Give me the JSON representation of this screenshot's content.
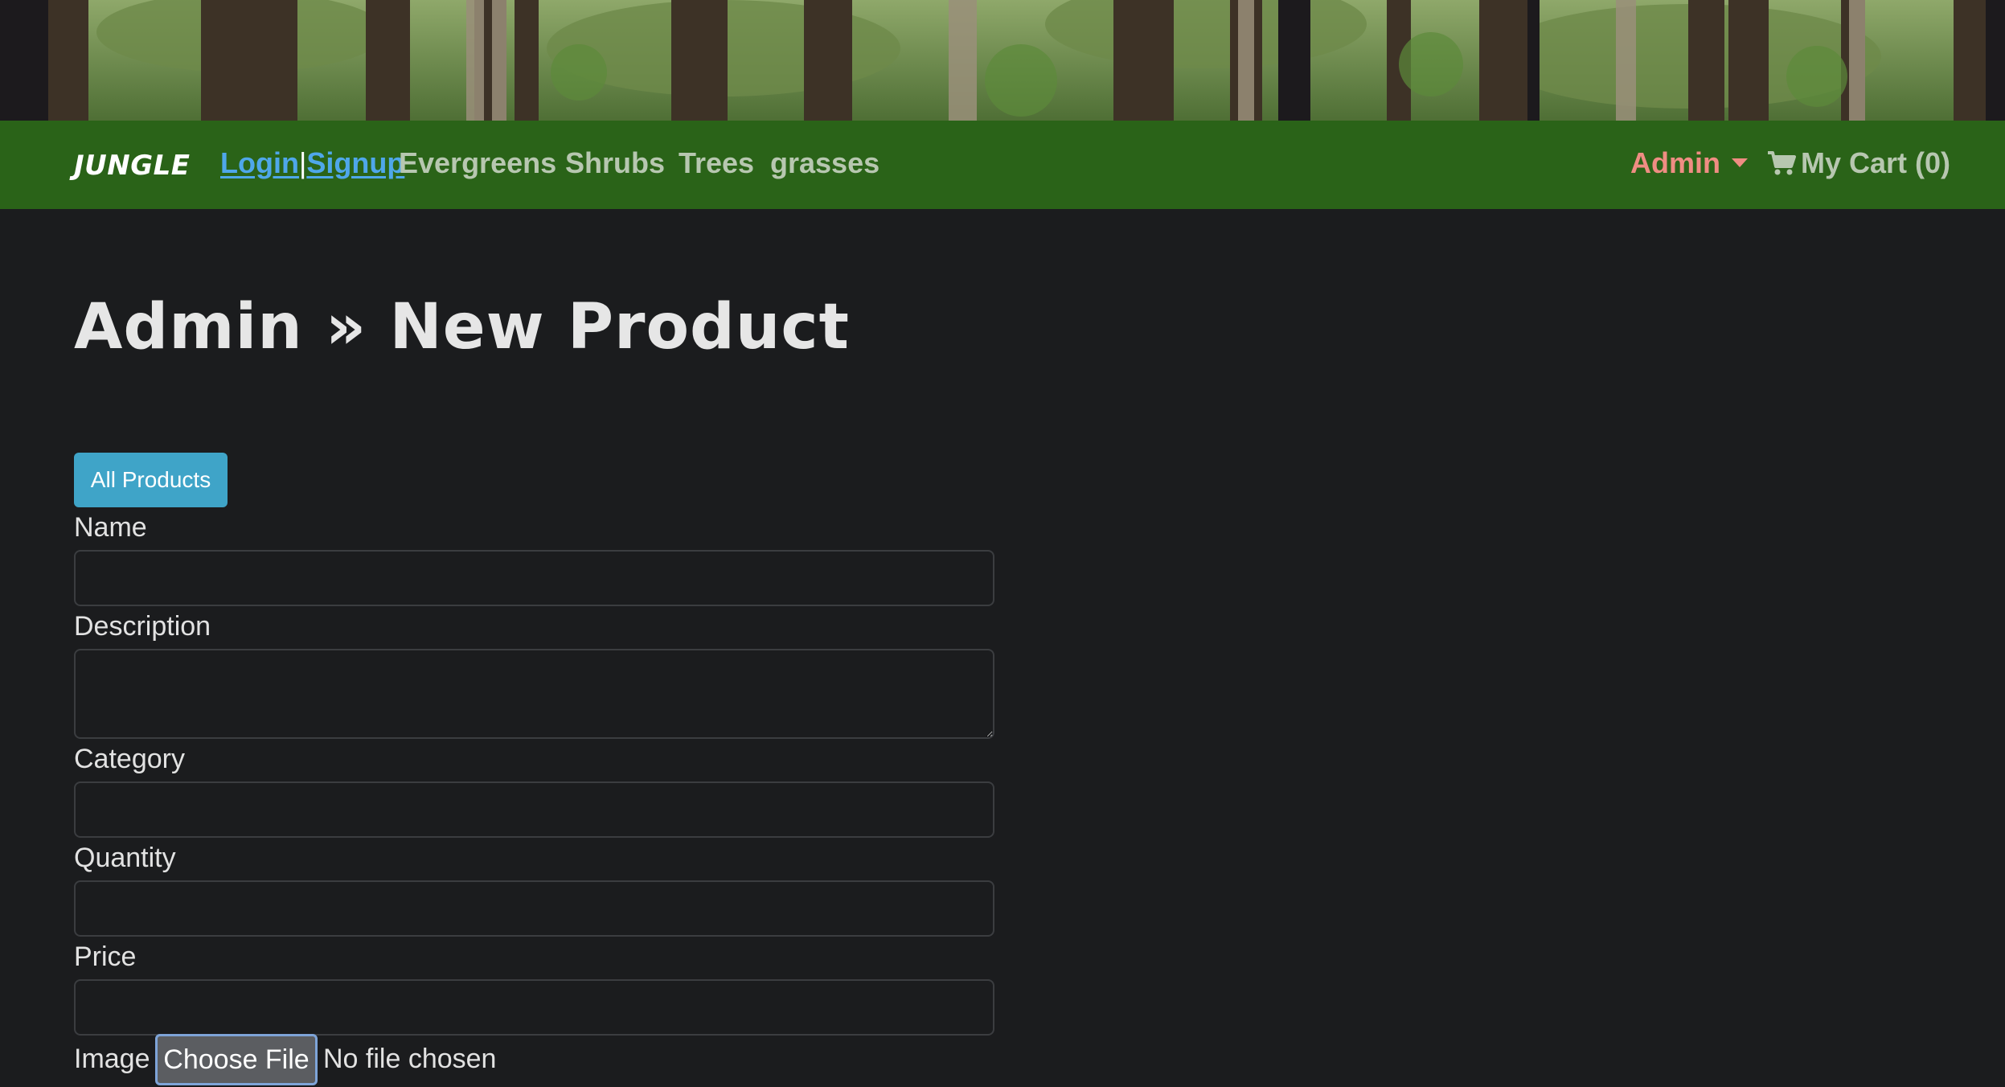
{
  "navbar": {
    "brand": "JUNGLE",
    "login_label": "Login",
    "separator": "|",
    "signup_label": "Signup",
    "categories": [
      "Evergreens",
      "Shrubs",
      "Trees",
      "grasses"
    ],
    "admin_label": "Admin",
    "cart_label": "My Cart (0)",
    "cart_icon": "cart-icon"
  },
  "main": {
    "title": "Admin » New Product",
    "all_products_label": "All Products"
  },
  "form": {
    "name_label": "Name",
    "name_value": "",
    "description_label": "Description",
    "description_value": "",
    "category_label": "Category",
    "category_value": "",
    "quantity_label": "Quantity",
    "quantity_value": "",
    "price_label": "Price",
    "price_value": "",
    "image_label": "Image",
    "choose_file_label": "Choose File",
    "file_status": "No file chosen"
  },
  "colors": {
    "page_background": "#1b1c1e",
    "navbar_background": "#2a6318",
    "auth_link": "#4fa7ea",
    "admin_link": "#ef8d83",
    "primary_button": "#3fa4c8"
  }
}
